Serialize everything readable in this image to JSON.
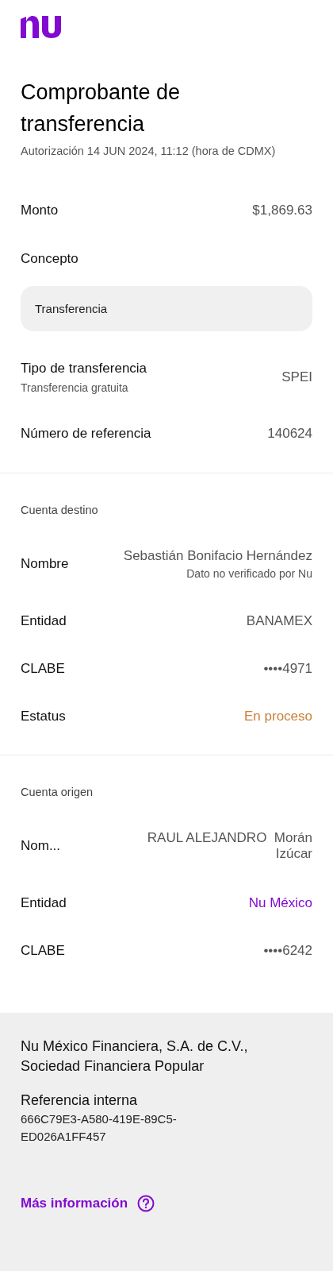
{
  "title": "Comprobante de transferencia",
  "subtitle": "Autorización 14 JUN 2024, 11:12 (hora de CDMX)",
  "summary": [
    {
      "kind": "row",
      "label": "Monto",
      "value": "$1,869.63",
      "color": "#555555"
    },
    {
      "kind": "field",
      "label": "Concepto",
      "value": "Transferencia"
    },
    {
      "kind": "row",
      "label": "Tipo de transferencia",
      "sublabel": "Transferencia gratuita",
      "value": "SPEI",
      "color": "#555555"
    },
    {
      "kind": "row",
      "label": "Número de referencia",
      "value": "140624",
      "color": "#555555"
    }
  ],
  "sections": [
    {
      "heading": "Cuenta destino",
      "rows": [
        {
          "label": "Nombre",
          "value": "Sebastián Bonifacio Hernández",
          "note": "Dato no verificado por Nu",
          "color": "#555555"
        },
        {
          "label": "Entidad",
          "value": "BANAMEX",
          "color": "#555555"
        },
        {
          "label": "CLABE",
          "value": "••••4971",
          "color": "#555555"
        },
        {
          "label": "Estatus",
          "value": "En proceso",
          "color": "#c9823a"
        }
      ]
    },
    {
      "heading": "Cuenta origen",
      "rows": [
        {
          "label": "Nom...",
          "value": "RAUL ALEJANDRO  Morán Izúcar",
          "color": "#555555"
        },
        {
          "label": "Entidad",
          "value": "Nu México",
          "color": "#820ad1"
        },
        {
          "label": "CLABE",
          "value": "••••6242",
          "color": "#555555"
        }
      ]
    }
  ],
  "footer": {
    "company": "Nu México Financiera, S.A. de C.V., Sociedad Financiera Popular",
    "ref_label": "Referencia interna",
    "ref_value": "666C79E3-A580-419E-89C5-ED026A1FF457",
    "link": "Más información"
  }
}
